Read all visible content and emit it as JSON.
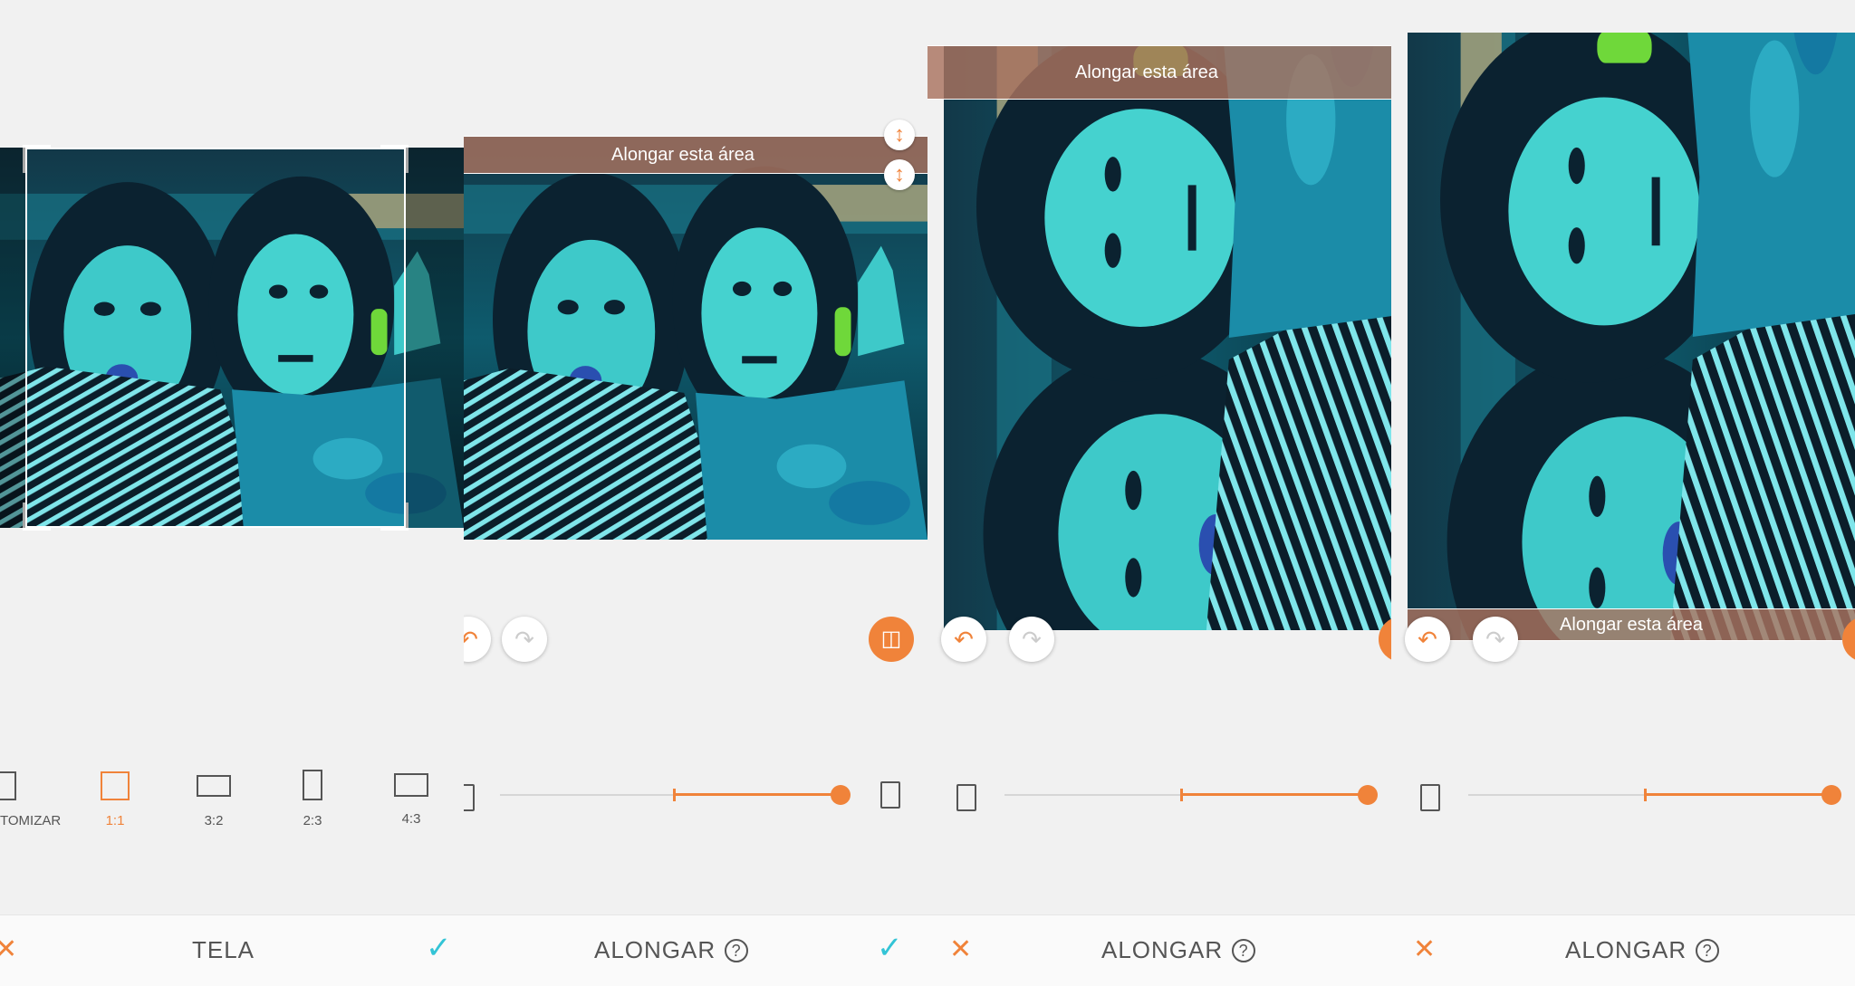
{
  "colors": {
    "accent": "#f0833a",
    "confirm": "#33c4d6",
    "banner": "#aa735f",
    "panel_bg": "#f1f1f1"
  },
  "panel1": {
    "ratios": [
      {
        "label": "TOMIZAR",
        "icon": "customize-icon",
        "active": false
      },
      {
        "label": "1:1",
        "icon": "square-icon",
        "active": true
      },
      {
        "label": "3:2",
        "icon": "landscape-3-2-icon",
        "active": false
      },
      {
        "label": "2:3",
        "icon": "portrait-2-3-icon",
        "active": false
      },
      {
        "label": "4:3",
        "icon": "landscape-4-3-icon",
        "active": false
      }
    ],
    "title": "TELA",
    "cancel_icon": "close-icon",
    "confirm_icon": "check-icon"
  },
  "panel2": {
    "banner": "Alongar esta área",
    "title": "ALONGAR",
    "help": "?",
    "slider_value": 1.0
  },
  "panel3": {
    "banner": "Alongar esta área",
    "title": "ALONGAR",
    "help": "?",
    "slider_value": 1.0
  },
  "panel4": {
    "banner": "Alongar esta área",
    "title": "ALONGAR",
    "help": "?",
    "slider_value": 1.0
  }
}
